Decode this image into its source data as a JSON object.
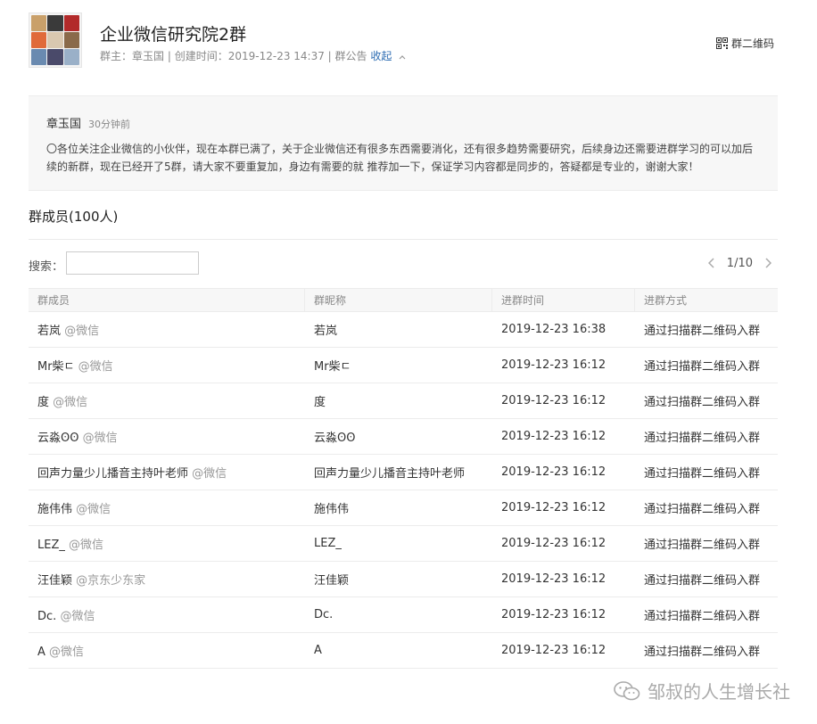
{
  "group": {
    "title": "企业微信研究院2群",
    "owner_label": "群主：",
    "owner": "章玉国",
    "created_label": " | 创建时间：",
    "created": "2019-12-23 14:37",
    "announce_label": " | 群公告",
    "toggle": "收起",
    "qr_label": "群二维码",
    "avatar_colors": [
      "#c9a06a",
      "#3a3a3a",
      "#b22a2a",
      "#e06a3a",
      "#d9c8b0",
      "#8a6a4a",
      "#6a8ab0",
      "#4a4a6a",
      "#9ab0c8"
    ]
  },
  "announcement": {
    "author": "章玉国",
    "time": "30分钟前",
    "text": "〇各位关注企业微信的小伙伴，现在本群已满了，关于企业微信还有很多东西需要消化，还有很多趋势需要研究，后续身边还需要进群学习的可以加后续的新群，现在已经开了5群，请大家不要重复加，身边有需要的就 推荐加一下，保证学习内容都是同步的，答疑都是专业的，谢谢大家！"
  },
  "members": {
    "title": "群成员(100人)",
    "search_label": "搜索：",
    "search_value": "",
    "search_placeholder": "",
    "page": "1/10",
    "headers": [
      "群成员",
      "群昵称",
      "进群时间",
      "进群方式"
    ],
    "rows": [
      {
        "name": "若岚",
        "source": "@微信",
        "nickname": "若岚",
        "joined": "2019-12-23 16:38",
        "method": "通过扫描群二维码入群"
      },
      {
        "name": "Mr柴ㄷ",
        "source": "@微信",
        "nickname": "Mr柴ㄷ",
        "joined": "2019-12-23 16:12",
        "method": "通过扫描群二维码入群"
      },
      {
        "name": "度",
        "source": "@微信",
        "nickname": "度",
        "joined": "2019-12-23 16:12",
        "method": "通过扫描群二维码入群"
      },
      {
        "name": "云淼ʘʘ",
        "source": "@微信",
        "nickname": "云淼ʘʘ",
        "joined": "2019-12-23 16:12",
        "method": "通过扫描群二维码入群"
      },
      {
        "name": "回声力量少儿播音主持叶老师",
        "source": "@微信",
        "nickname": "回声力量少儿播音主持叶老师",
        "joined": "2019-12-23 16:12",
        "method": "通过扫描群二维码入群"
      },
      {
        "name": "施伟伟",
        "source": "@微信",
        "nickname": "施伟伟",
        "joined": "2019-12-23 16:12",
        "method": "通过扫描群二维码入群"
      },
      {
        "name": "LEZ_",
        "source": "@微信",
        "nickname": "LEZ_",
        "joined": "2019-12-23 16:12",
        "method": "通过扫描群二维码入群"
      },
      {
        "name": "汪佳颖",
        "source": "@京东少东家",
        "nickname": "汪佳颖",
        "joined": "2019-12-23 16:12",
        "method": "通过扫描群二维码入群"
      },
      {
        "name": "Dc.",
        "source": "@微信",
        "nickname": "Dc.",
        "joined": "2019-12-23 16:12",
        "method": "通过扫描群二维码入群"
      },
      {
        "name": "A",
        "source": "@微信",
        "nickname": "A",
        "joined": "2019-12-23 16:12",
        "method": "通过扫描群二维码入群"
      }
    ]
  },
  "watermark": {
    "text": "邹叔的人生增长社",
    "icon": "wechat-icon"
  }
}
